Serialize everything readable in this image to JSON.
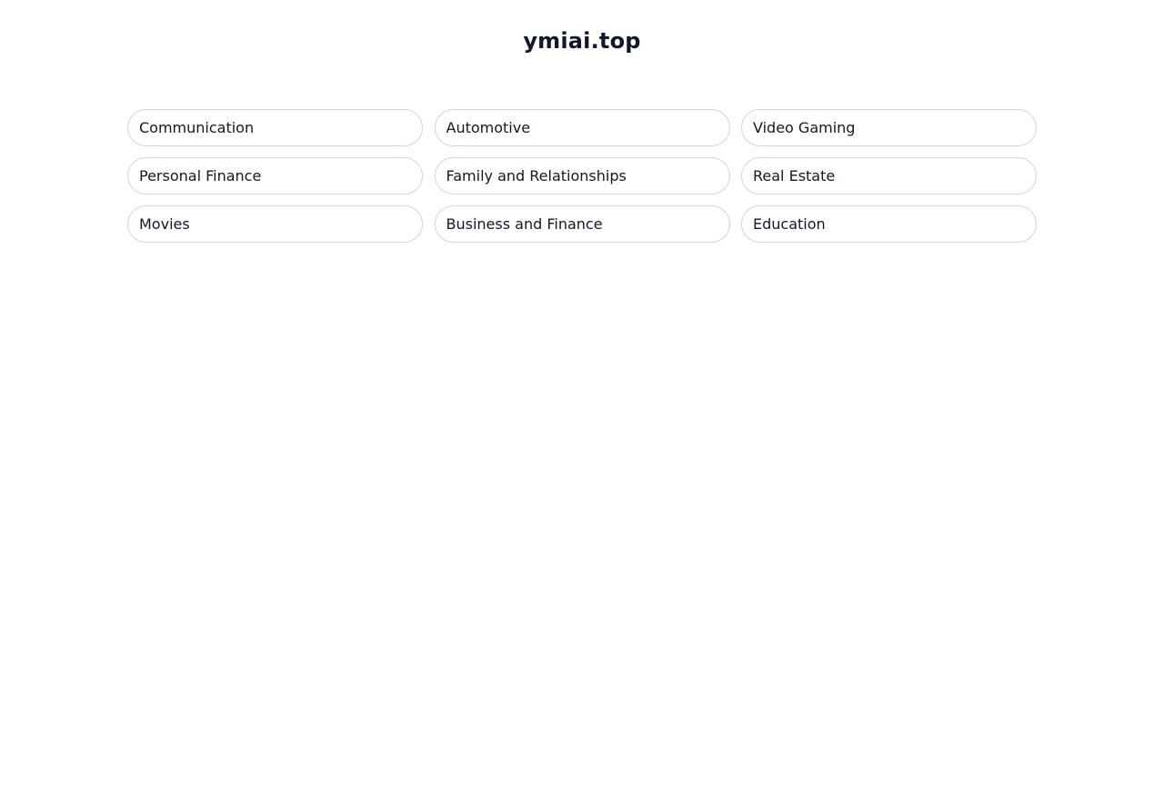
{
  "site": {
    "title": "ymiai.top"
  },
  "topics": [
    {
      "label": "Communication"
    },
    {
      "label": "Automotive"
    },
    {
      "label": "Video Gaming"
    },
    {
      "label": "Personal Finance"
    },
    {
      "label": "Family and Relationships"
    },
    {
      "label": "Real Estate"
    },
    {
      "label": "Movies"
    },
    {
      "label": "Business and Finance"
    },
    {
      "label": "Education"
    }
  ],
  "colors": {
    "text": "#111827",
    "pill_border": "#d1d5db",
    "background": "#ffffff"
  }
}
